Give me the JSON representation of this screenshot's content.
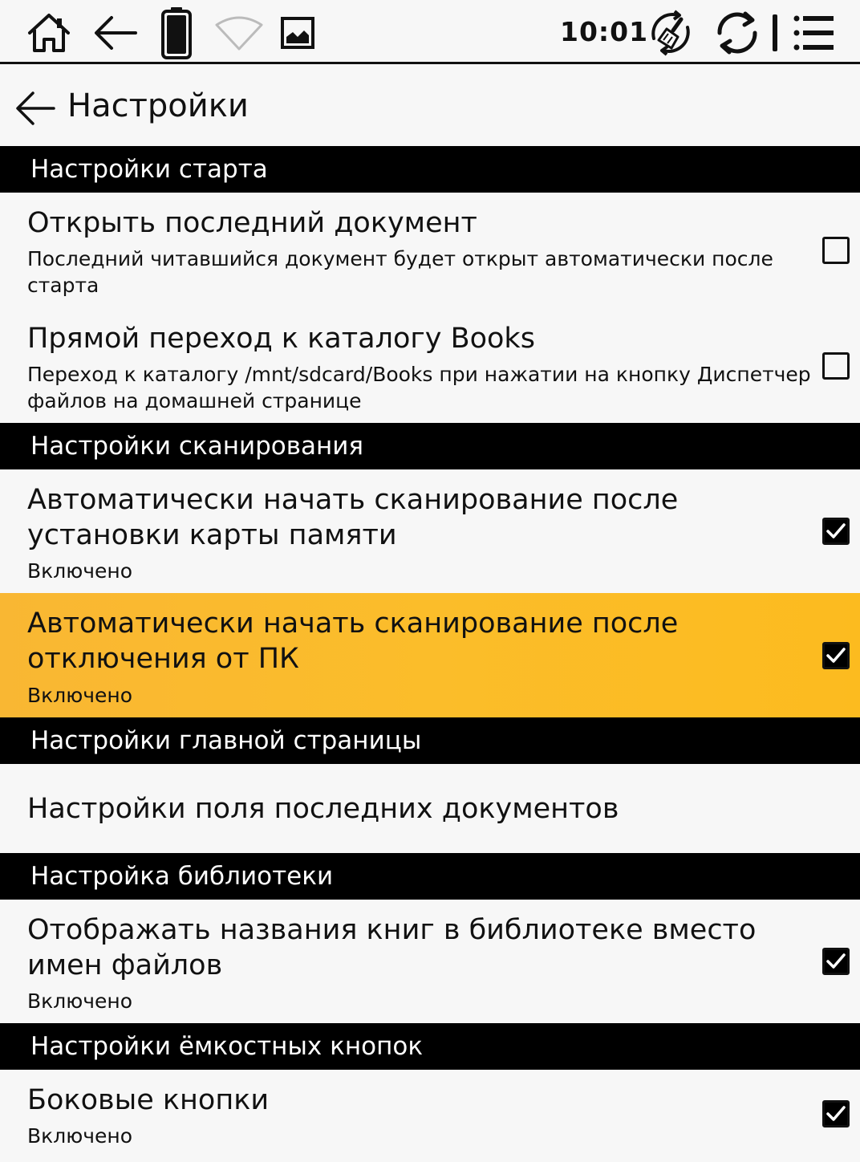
{
  "status_bar": {
    "time": "10:01",
    "icons": [
      "home-icon",
      "back-arrow-icon",
      "battery-icon",
      "wifi-icon",
      "image-icon",
      "clean-broom-icon",
      "sync-icon",
      "menu-icon"
    ]
  },
  "header": {
    "title": "Настройки"
  },
  "sections": [
    {
      "header": "Настройки старта",
      "items": [
        {
          "title": "Открыть последний документ",
          "subtitle": "Последний читавшийся документ будет открыт автоматически после старта",
          "checked": false
        },
        {
          "title": "Прямой переход к каталогу Books",
          "subtitle": "Переход к каталогу /mnt/sdcard/Books при нажатии на кнопку Диспетчер файлов на домашней странице",
          "checked": false
        }
      ]
    },
    {
      "header": "Настройки сканирования",
      "items": [
        {
          "title": "Автоматически начать сканирование после установки карты памяти",
          "subtitle": "Включено",
          "checked": true
        },
        {
          "title": "Автоматически начать сканирование после отключения от ПК",
          "subtitle": "Включено",
          "checked": true,
          "highlighted": true
        }
      ]
    },
    {
      "header": "Настройки главной страницы",
      "items": [
        {
          "title": "Настройки поля последних документов"
        }
      ]
    },
    {
      "header": "Настройка библиотеки",
      "items": [
        {
          "title": "Отображать названия книг в библиотеке вместо имен файлов",
          "subtitle": "Включено",
          "checked": true
        }
      ]
    },
    {
      "header": "Настройки ёмкостных кнопок",
      "items": [
        {
          "title": "Боковые кнопки",
          "subtitle": "Включено",
          "checked": true
        }
      ]
    }
  ],
  "colors": {
    "highlight": "#fbbd2a",
    "section_header_bg": "#000000",
    "background": "#f7f7f7"
  }
}
